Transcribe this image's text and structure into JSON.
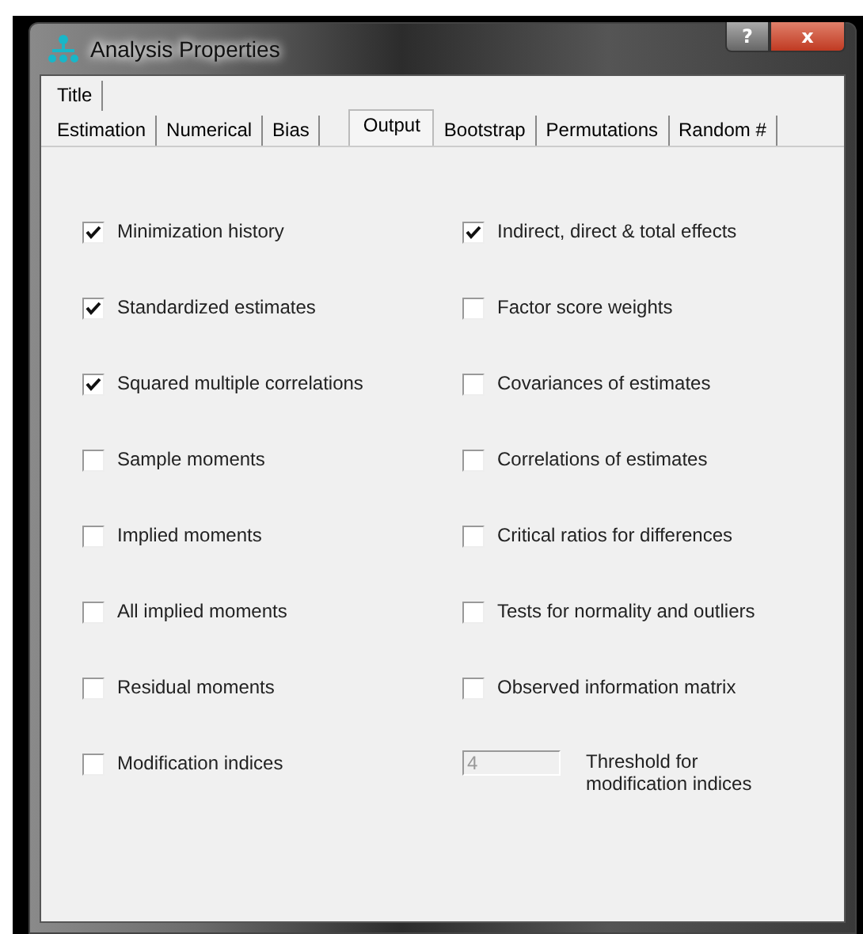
{
  "window": {
    "title": "Analysis Properties",
    "help_button": "?",
    "close_button": "x"
  },
  "tab_rows": [
    {
      "tabs": [
        {
          "label": "Title",
          "selected": false
        }
      ]
    },
    {
      "tabs": [
        {
          "label": "Estimation",
          "selected": false
        },
        {
          "label": "Numerical",
          "selected": false
        },
        {
          "label": "Bias",
          "selected": false
        },
        {
          "label": "Output",
          "selected": true
        },
        {
          "label": "Bootstrap",
          "selected": false
        },
        {
          "label": "Permutations",
          "selected": false
        },
        {
          "label": "Random #",
          "selected": false
        }
      ]
    }
  ],
  "columns": [
    [
      {
        "label": "Minimization history",
        "checked": true
      },
      {
        "label": "Standardized estimates",
        "checked": true
      },
      {
        "label": "Squared multiple correlations",
        "checked": true
      },
      {
        "label": "Sample moments",
        "checked": false
      },
      {
        "label": "Implied moments",
        "checked": false
      },
      {
        "label": "All implied moments",
        "checked": false
      },
      {
        "label": "Residual moments",
        "checked": false
      },
      {
        "label": "Modification indices",
        "checked": false
      }
    ],
    [
      {
        "label": "Indirect, direct & total effects",
        "checked": true
      },
      {
        "label": "Factor score weights",
        "checked": false
      },
      {
        "label": "Covariances of estimates",
        "checked": false
      },
      {
        "label": "Correlations of estimates",
        "checked": false
      },
      {
        "label": "Critical ratios for differences",
        "checked": false
      },
      {
        "label": "Tests for normality and outliers",
        "checked": false
      },
      {
        "label": "Observed information matrix",
        "checked": false
      }
    ]
  ],
  "threshold": {
    "value": "4",
    "disabled": true,
    "label": "Threshold for modification indices"
  }
}
